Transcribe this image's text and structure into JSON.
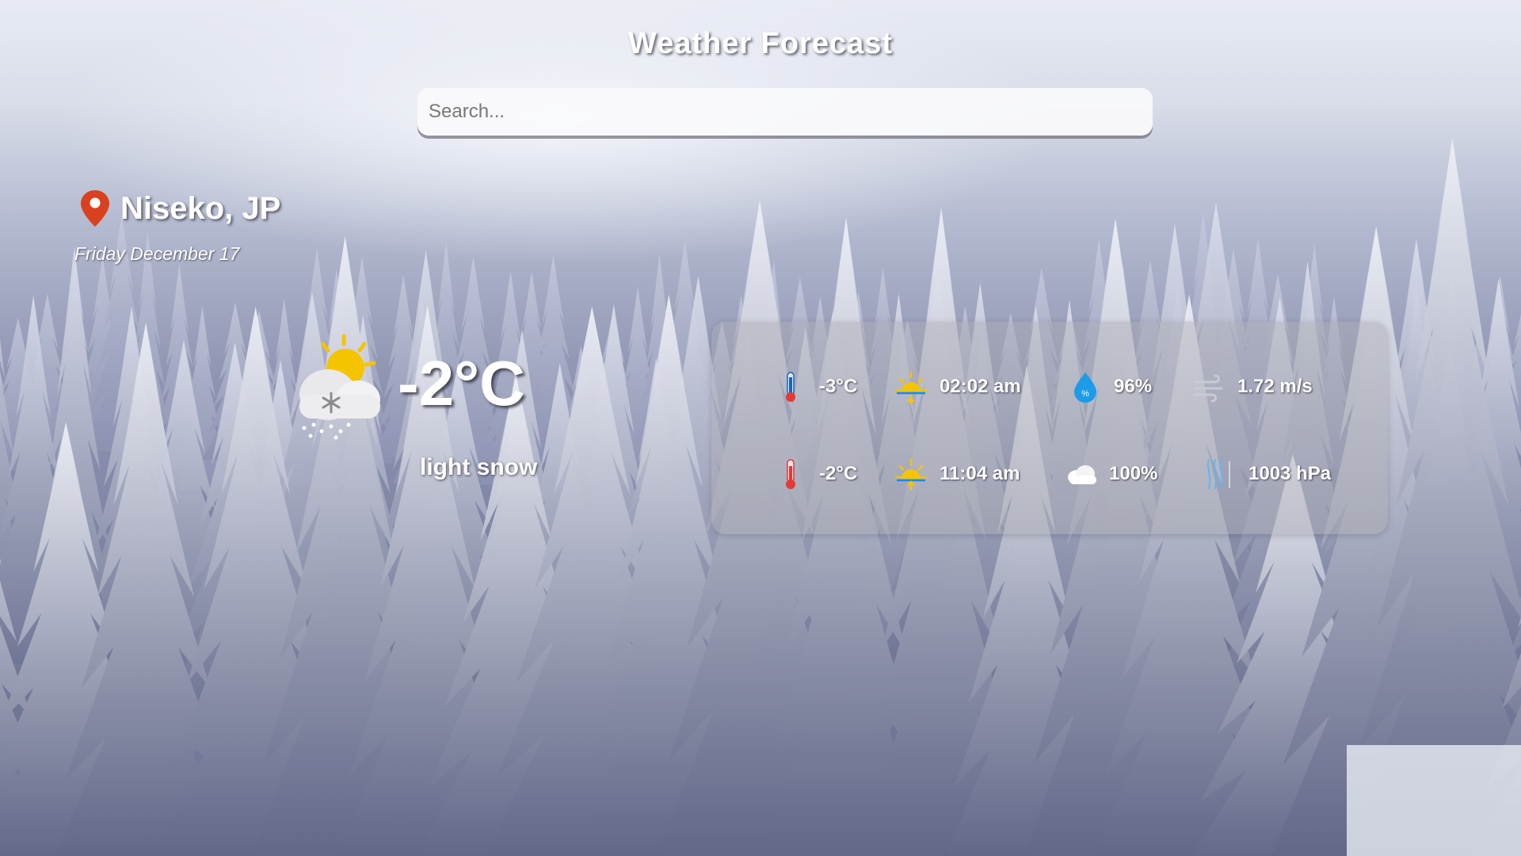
{
  "header": {
    "title": "Weather Forecast"
  },
  "search": {
    "placeholder": "Search..."
  },
  "location": {
    "city": "Niseko, JP",
    "date": "Friday December 17"
  },
  "current": {
    "icon": "snow-sun-cloud-icon",
    "temperature": "-2°C",
    "description": "light snow"
  },
  "details": {
    "temp_min": {
      "icon": "thermometer-cold-icon",
      "value": "-3°C"
    },
    "sunrise": {
      "icon": "sunrise-icon",
      "value": "02:02 am"
    },
    "humidity": {
      "icon": "humidity-drop-icon",
      "value": "96%"
    },
    "wind": {
      "icon": "wind-icon",
      "value": "1.72 m/s"
    },
    "temp_max": {
      "icon": "thermometer-warm-icon",
      "value": "-2°C"
    },
    "sunset": {
      "icon": "sunset-icon",
      "value": "11:04 am"
    },
    "clouds": {
      "icon": "cloud-icon",
      "value": "100%"
    },
    "pressure": {
      "icon": "pressure-icon",
      "value": "1003 hPa"
    }
  },
  "colors": {
    "pin": "#d9411e",
    "sun": "#f5c400",
    "drop": "#1e9be8",
    "thermo_red": "#e53935",
    "thermo_blue": "#1565c0"
  }
}
